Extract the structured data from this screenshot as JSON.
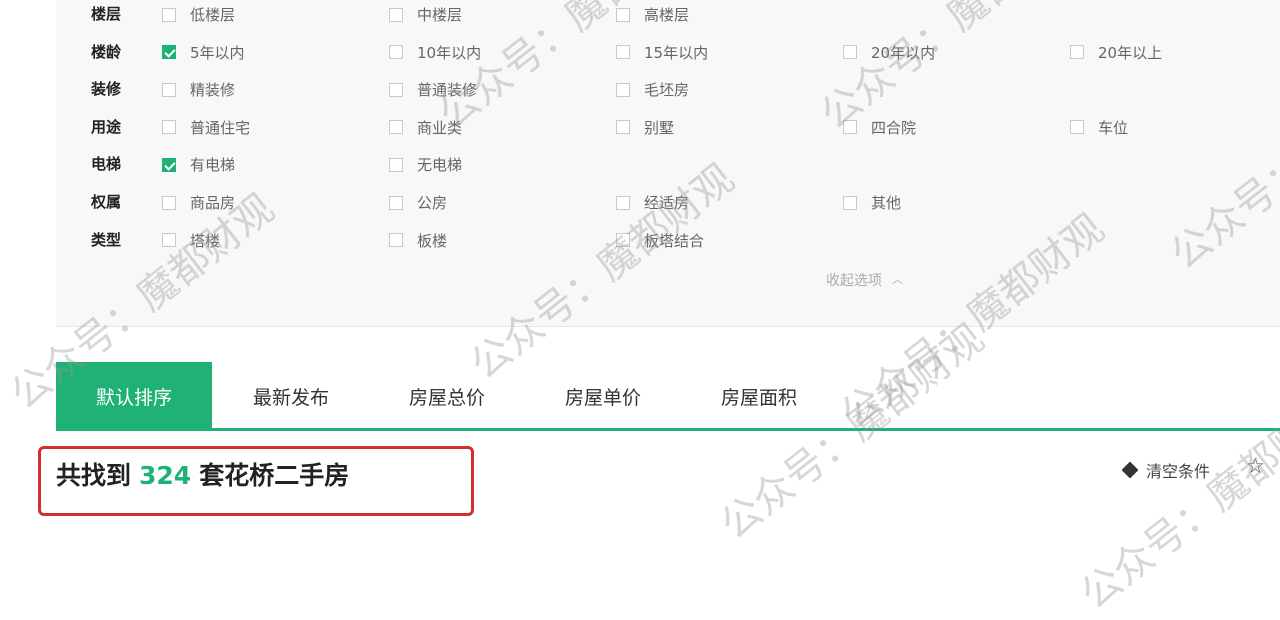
{
  "filters": [
    {
      "label": "楼层",
      "options": [
        {
          "text": "低楼层",
          "checked": false
        },
        {
          "text": "中楼层",
          "checked": false
        },
        {
          "text": "高楼层",
          "checked": false
        }
      ]
    },
    {
      "label": "楼龄",
      "options": [
        {
          "text": "5年以内",
          "checked": true
        },
        {
          "text": "10年以内",
          "checked": false
        },
        {
          "text": "15年以内",
          "checked": false
        },
        {
          "text": "20年以内",
          "checked": false
        },
        {
          "text": "20年以上",
          "checked": false
        }
      ]
    },
    {
      "label": "装修",
      "options": [
        {
          "text": "精装修",
          "checked": false
        },
        {
          "text": "普通装修",
          "checked": false
        },
        {
          "text": "毛坯房",
          "checked": false
        }
      ]
    },
    {
      "label": "用途",
      "options": [
        {
          "text": "普通住宅",
          "checked": false
        },
        {
          "text": "商业类",
          "checked": false
        },
        {
          "text": "别墅",
          "checked": false
        },
        {
          "text": "四合院",
          "checked": false
        },
        {
          "text": "车位",
          "checked": false
        }
      ]
    },
    {
      "label": "电梯",
      "options": [
        {
          "text": "有电梯",
          "checked": true
        },
        {
          "text": "无电梯",
          "checked": false
        }
      ]
    },
    {
      "label": "权属",
      "options": [
        {
          "text": "商品房",
          "checked": false
        },
        {
          "text": "公房",
          "checked": false
        },
        {
          "text": "经适房",
          "checked": false
        },
        {
          "text": "其他",
          "checked": false
        }
      ]
    },
    {
      "label": "类型",
      "options": [
        {
          "text": "塔楼",
          "checked": false
        },
        {
          "text": "板楼",
          "checked": false
        },
        {
          "text": "板塔结合",
          "checked": false
        }
      ]
    }
  ],
  "collapse_label": "收起选项",
  "sort_tabs": [
    {
      "label": "默认排序",
      "active": true
    },
    {
      "label": "最新发布",
      "active": false
    },
    {
      "label": "房屋总价",
      "active": false
    },
    {
      "label": "房屋单价",
      "active": false
    },
    {
      "label": "房屋面积",
      "active": false
    }
  ],
  "result": {
    "prefix": "共找到",
    "count": "324",
    "suffix": "套花桥二手房"
  },
  "clear_label": "清空条件",
  "watermarks": [
    "公众号：魔都财观",
    "公众号：魔都财观",
    "公众号：魔都财观",
    "公众号：魔都财观",
    "公众号：魔都财观",
    "公众号：魔都财观",
    "公众号：魔都财观",
    "公众号：魔都财观"
  ],
  "colors": {
    "accent": "#1fb175",
    "highlight_box": "#d32f2f"
  }
}
